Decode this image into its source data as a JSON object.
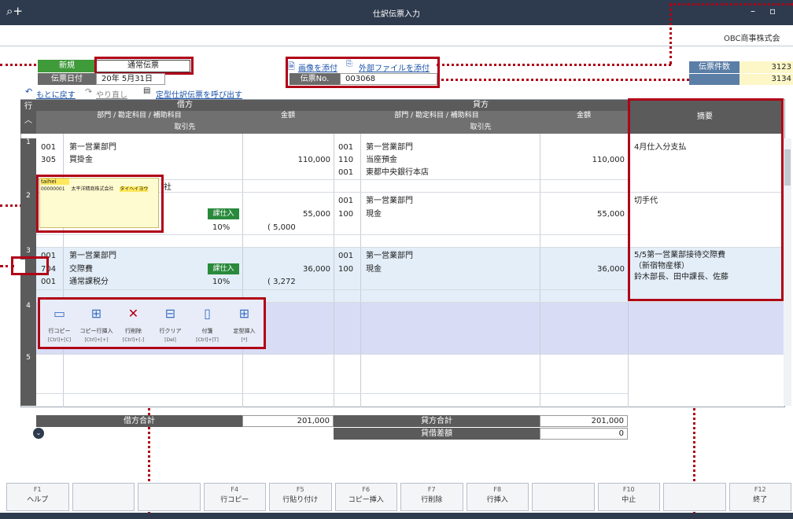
{
  "window": {
    "title": "仕訳伝票入力",
    "company": "OBC商事株式会"
  },
  "header": {
    "mode": "新規",
    "voucher_type": "通常伝票",
    "date_label": "伝票日付",
    "date_value": "20年 5月31日",
    "attach_image": "画像を添付",
    "attach_file": "外部ファイルを添付",
    "voucher_no_label": "伝票No.",
    "voucher_no": "003068",
    "count_label": "伝票件数",
    "count_value": "3123",
    "count2_value": "3134",
    "undo": "もとに戻す",
    "redo": "やり直し",
    "template": "定型仕訳伝票を呼び出す"
  },
  "grid": {
    "row_header": "行",
    "debit": "借方",
    "credit": "貸方",
    "dept_account": "部門 / 勘定科目 / 補助科目",
    "amount": "金額",
    "partner": "取引先",
    "memo": "摘要"
  },
  "rows": [
    {
      "num": "1",
      "d_dept_code": "001",
      "d_dept": "第一営業部門",
      "d_acct_code": "305",
      "d_acct": "買掛金",
      "d_amount": "110,000",
      "d_partner_tail": "社",
      "c_dept_code": "001",
      "c_dept": "第一営業部門",
      "c_acct_code": "110",
      "c_acct": "当座預金",
      "c_sub_code": "001",
      "c_sub": "東都中央銀行本店",
      "c_amount": "110,000",
      "memo": "4月仕入分支払"
    },
    {
      "num": "2",
      "d_tax": "課仕入",
      "d_rate": "10%",
      "d_amount": "55,000",
      "d_tax_amount": "( 5,000",
      "c_dept_code": "001",
      "c_dept": "第一営業部門",
      "c_acct_code": "100",
      "c_acct": "現金",
      "c_amount": "55,000",
      "memo": "切手代"
    },
    {
      "num": "3",
      "d_dept_code": "001",
      "d_dept": "第一営業部門",
      "d_acct_code": "704",
      "d_acct": "交際費",
      "d_sub_code": "001",
      "d_sub": "通常課税分",
      "d_tax": "課仕入",
      "d_rate": "10%",
      "d_amount": "36,000",
      "d_tax_amount": "( 3,272",
      "c_dept_code": "001",
      "c_dept": "第一営業部門",
      "c_acct_code": "100",
      "c_acct": "現金",
      "c_amount": "36,000",
      "memo": "5/5第一営業部接待交際費\n（新宿物産様）\n鈴木部長、田中課長、佐藤"
    },
    {
      "num": "4"
    },
    {
      "num": "5"
    }
  ],
  "suggest": {
    "input": "taihei",
    "code": "00000001",
    "name": "太平洋精商株式会社",
    "kana": "タイヘイヨウ"
  },
  "toolbar": [
    {
      "label": "行コピー",
      "key": "[Ctrl]+[C]",
      "icon": "row-copy-icon"
    },
    {
      "label": "コピー行挿入",
      "key": "[Ctrl]+[+]",
      "icon": "insert-copy-row-icon"
    },
    {
      "label": "行削除",
      "key": "[Ctrl]+[-]",
      "icon": "row-delete-icon"
    },
    {
      "label": "行クリア",
      "key": "[Del]",
      "icon": "row-clear-icon"
    },
    {
      "label": "付箋",
      "key": "[Ctrl]+[T]",
      "icon": "sticky-note-icon"
    },
    {
      "label": "定型挿入",
      "key": "[*]",
      "icon": "template-insert-icon"
    }
  ],
  "totals": {
    "debit_label": "借方合計",
    "debit_value": "201,000",
    "credit_label": "貸方合計",
    "credit_value": "201,000",
    "diff_label": "貸借差額",
    "diff_value": "0"
  },
  "fkeys": [
    {
      "key": "F1",
      "label": "ヘルプ"
    },
    {
      "key": "",
      "label": ""
    },
    {
      "key": "",
      "label": ""
    },
    {
      "key": "F4",
      "label": "行コピー"
    },
    {
      "key": "F5",
      "label": "行貼り付け"
    },
    {
      "key": "F6",
      "label": "コピー挿入"
    },
    {
      "key": "F7",
      "label": "行削除"
    },
    {
      "key": "F8",
      "label": "行挿入"
    },
    {
      "key": "",
      "label": ""
    },
    {
      "key": "F10",
      "label": "中止"
    },
    {
      "key": "",
      "label": ""
    },
    {
      "key": "F12",
      "label": "終了"
    }
  ],
  "colors": {
    "titlebar": "#2e3a4d",
    "highlight_red": "#b00017",
    "row_blue": "#dde6fa",
    "tax_green": "#2a8a3c"
  }
}
